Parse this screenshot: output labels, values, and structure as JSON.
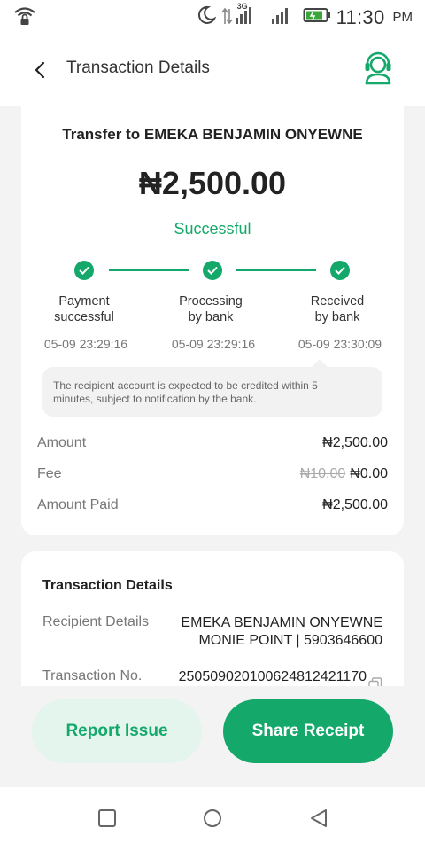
{
  "status_bar": {
    "network_label": "3G",
    "time": "11:30",
    "ampm": "PM",
    "icons": [
      "wifi-lock-icon",
      "moon-icon",
      "data-arrows-icon",
      "signal-icon",
      "signal-icon",
      "battery-icon"
    ]
  },
  "header": {
    "title": "Transaction Details",
    "back_icon": "back-chevron-icon",
    "support_icon": "headset-icon"
  },
  "transfer": {
    "title": "Transfer to EMEKA BENJAMIN ONYEWNE",
    "amount": "₦2,500.00",
    "status": "Successful"
  },
  "steps": [
    {
      "label_line1": "Payment",
      "label_line2": "successful",
      "time": "05-09 23:29:16"
    },
    {
      "label_line1": "Processing",
      "label_line2": "by bank",
      "time": "05-09 23:29:16"
    },
    {
      "label_line1": "Received",
      "label_line2": "by bank",
      "time": "05-09 23:30:09"
    }
  ],
  "note": {
    "line1": "The recipient account is expected to be credited within 5",
    "line2": "minutes, subject to notification by the bank."
  },
  "summary": {
    "amount_label": "Amount",
    "amount_value": "₦2,500.00",
    "fee_label": "Fee",
    "fee_original": "₦10.00",
    "fee_value": "₦0.00",
    "paid_label": "Amount Paid",
    "paid_value": "₦2,500.00"
  },
  "details": {
    "title": "Transaction Details",
    "recipient_label": "Recipient Details",
    "recipient_name": "EMEKA BENJAMIN ONYEWNE",
    "recipient_bank": "MONIE POINT | 5903646600",
    "txn_label": "Transaction No.",
    "txn_value": "250509020100624812421170"
  },
  "actions": {
    "report_label": "Report Issue",
    "share_label": "Share Receipt"
  },
  "nav": {
    "icons": [
      "recents-square-icon",
      "home-circle-icon",
      "back-triangle-icon"
    ]
  },
  "colors": {
    "accent": "#14a86b",
    "accent_light": "#e3f5ec"
  }
}
